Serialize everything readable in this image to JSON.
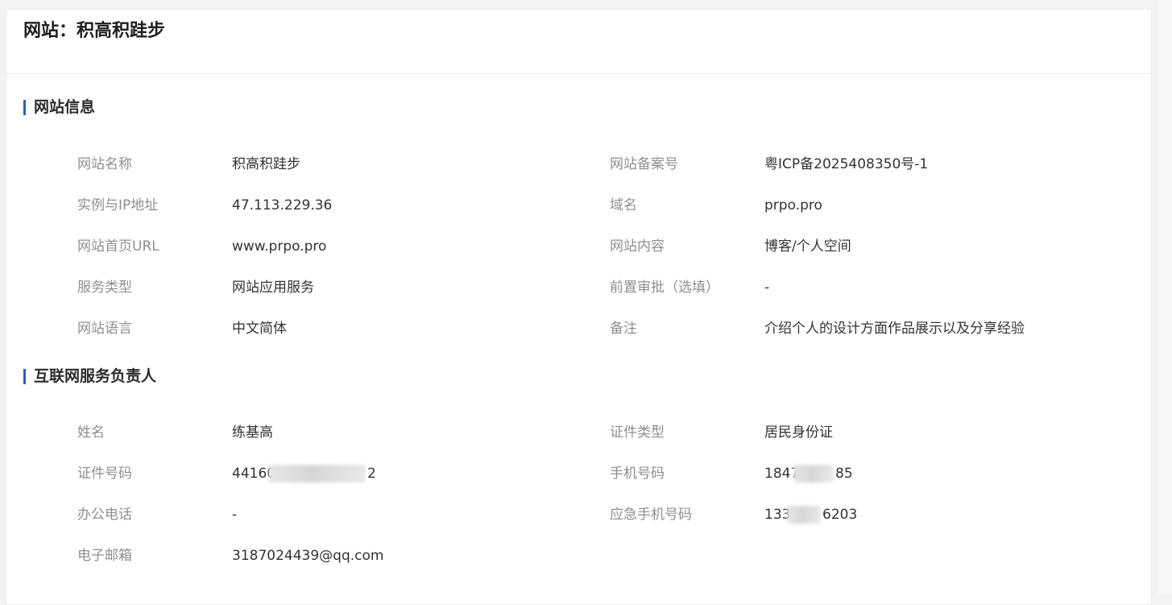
{
  "page": {
    "title": "网站：积高积跬步"
  },
  "site_info": {
    "heading": "网站信息",
    "fields": [
      {
        "label": "网站名称",
        "value": "积高积跬步"
      },
      {
        "label": "网站备案号",
        "value": "粤ICP备2025408350号-1"
      },
      {
        "label": "实例与IP地址",
        "value": "47.113.229.36"
      },
      {
        "label": "域名",
        "value": "prpo.pro"
      },
      {
        "label": "网站首页URL",
        "value": "www.prpo.pro"
      },
      {
        "label": "网站内容",
        "value": "博客/个人空间"
      },
      {
        "label": "服务类型",
        "value": "网站应用服务"
      },
      {
        "label": "前置审批（选填）",
        "value": "-"
      },
      {
        "label": "网站语言",
        "value": "中文简体"
      },
      {
        "label": "备注",
        "value": "介绍个人的设计方面作品展示以及分享经验"
      }
    ]
  },
  "contact": {
    "heading": "互联网服务负责人",
    "fields": [
      {
        "label": "姓名",
        "value": "练基高"
      },
      {
        "label": "证件类型",
        "value": "居民身份证"
      },
      {
        "label": "证件号码",
        "value": "44160",
        "value_tail": "2"
      },
      {
        "label": "手机号码",
        "value": "1847",
        "value_tail": "85"
      },
      {
        "label": "办公电话",
        "value": "-"
      },
      {
        "label": "应急手机号码",
        "value": "133",
        "value_tail": "6203"
      },
      {
        "label": "电子邮箱",
        "value": "3187024439@qq.com"
      }
    ]
  }
}
